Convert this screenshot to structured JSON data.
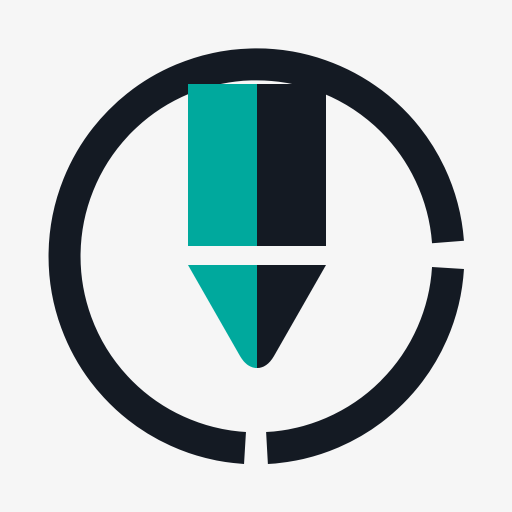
{
  "logo": {
    "icon": "pencil-download-ring-icon",
    "colors": {
      "background": "#f6f6f6",
      "ring": "#141a23",
      "accent_teal": "#00a99d",
      "dark": "#141a23"
    }
  }
}
